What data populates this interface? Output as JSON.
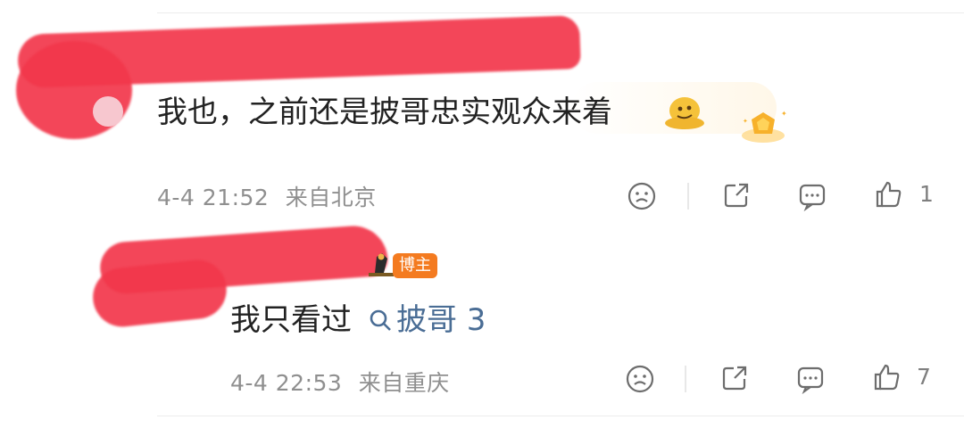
{
  "comments": [
    {
      "text": "我也，之前还是披哥忠实观众来着",
      "emoji": "melting-face-emoji",
      "badge": "fan-level-badge",
      "time": "4-4 21:52",
      "location": "来自北京",
      "like_count": "1"
    },
    {
      "owner_badge": "博主",
      "text_prefix": "我只看过",
      "search_term": "披哥 3",
      "time": "4-4 22:53",
      "location": "来自重庆",
      "like_count": "7"
    }
  ],
  "icons": {
    "dislike": "sad-face-icon",
    "share": "share-icon",
    "comment": "comment-icon",
    "like": "thumbs-up-icon",
    "search": "search-icon"
  },
  "colors": {
    "redaction": "#f2374b",
    "link": "#4a6d95",
    "owner_badge": "#f47b20",
    "meta_text": "#8f8f8f"
  }
}
